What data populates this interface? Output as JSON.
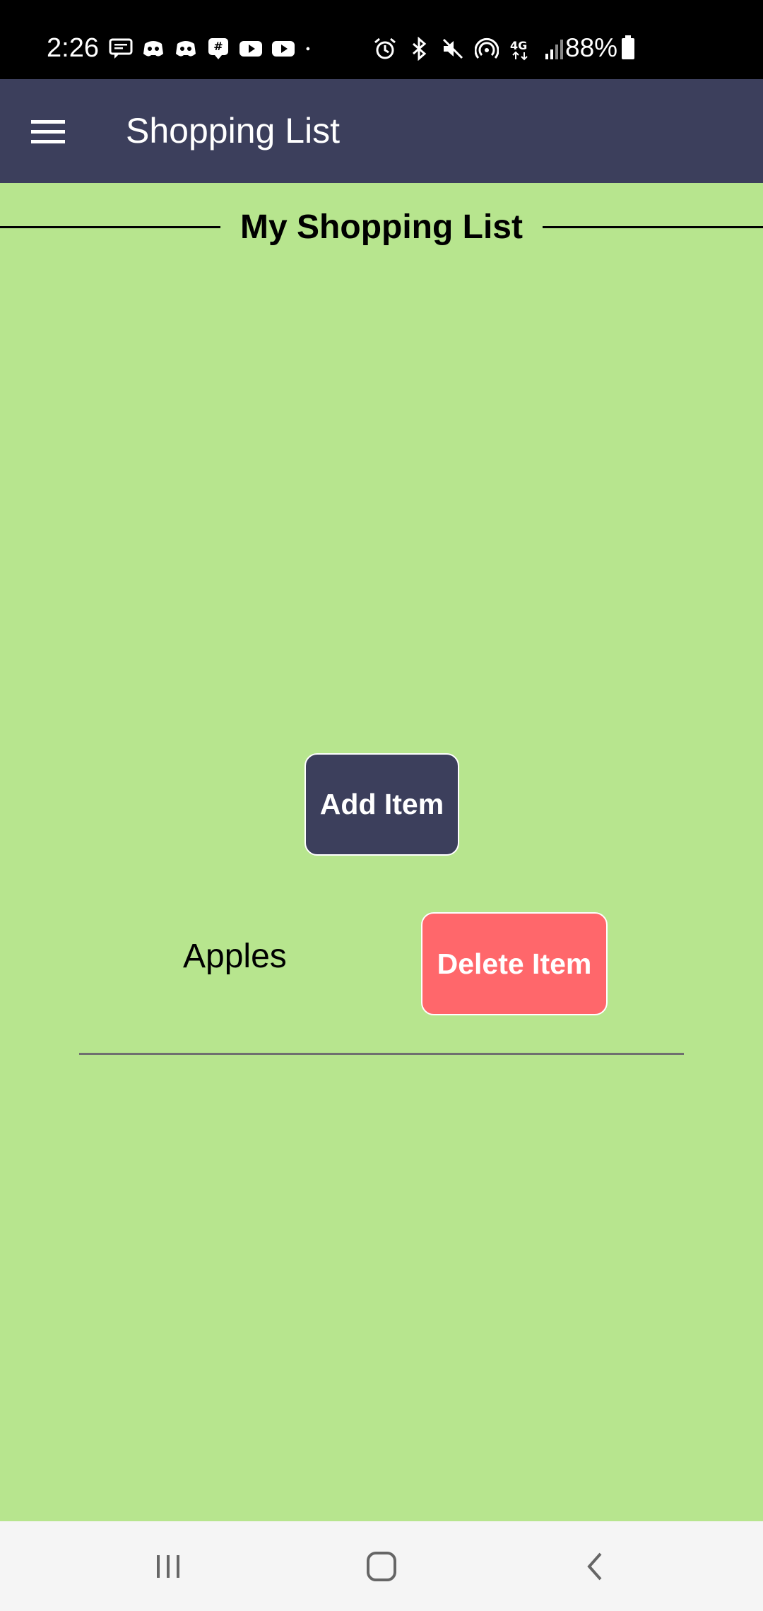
{
  "status_bar": {
    "time": "2:26",
    "battery_text": "88%",
    "left_icons": [
      "message-icon",
      "discord-icon",
      "discord-icon",
      "groupme-icon",
      "youtube-icon",
      "youtube-icon",
      "dot-icon"
    ],
    "right_icons": [
      "alarm-icon",
      "bluetooth-icon",
      "mute-icon",
      "hotspot-icon",
      "4g-lte-icon",
      "signal-icon",
      "battery-icon"
    ]
  },
  "app_bar": {
    "title": "Shopping List",
    "background": "#3c3f5c"
  },
  "page": {
    "heading": "My Shopping List",
    "background": "#b7e58e"
  },
  "actions": {
    "add_label": "Add Item"
  },
  "list": {
    "items": [
      {
        "label": "Apples",
        "delete_label": "Delete Item"
      }
    ],
    "delete_color": "#ff676b"
  },
  "nav_bar": {
    "buttons": [
      "recents-icon",
      "home-icon",
      "back-icon"
    ]
  }
}
